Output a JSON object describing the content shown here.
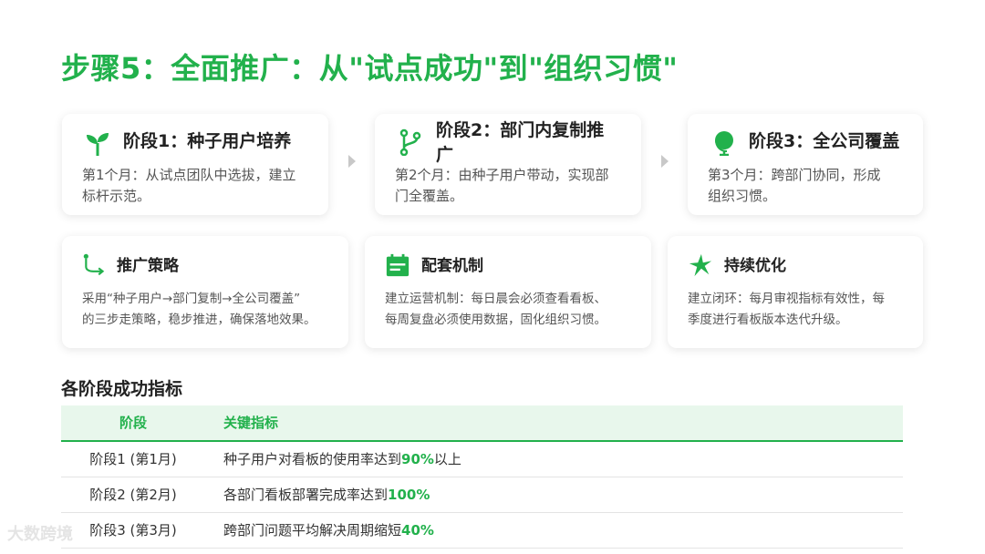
{
  "title": "步骤5：全面推广：从\"试点成功\"到\"组织习惯\"",
  "colors": {
    "accent": "#22b14c",
    "header_bg": "#e8f7ec"
  },
  "phases": [
    {
      "icon": "sprout-icon",
      "title": "阶段1：种子用户培养",
      "desc_l1": "第1个月：从试点团队中选拔，建立",
      "desc_l2": "标杆示范。"
    },
    {
      "icon": "branch-icon",
      "title_l1": "阶段2：部门内复制推",
      "title_l2": "广",
      "desc_l1": "第2个月：由种子用户带动，实现部",
      "desc_l2": "门全覆盖。"
    },
    {
      "icon": "globe-icon",
      "title": "阶段3：全公司覆盖",
      "desc_l1": "第3个月：跨部门协同，形成",
      "desc_l2": "组织习惯。"
    }
  ],
  "features": [
    {
      "icon": "route-icon",
      "title": "推广策略",
      "desc_l1": "采用“种子用户→部门复制→全公司覆盖”",
      "desc_l2": "的三步走策略，稳步推进，确保落地效果。"
    },
    {
      "icon": "calendar-icon",
      "title": "配套机制",
      "desc_l1": "建立运营机制：每日晨会必须查看看板、",
      "desc_l2": "每周复盘必须使用数据，固化组织习惯。"
    },
    {
      "icon": "sparkle-icon",
      "title": "持续优化",
      "desc_l1": "建立闭环：每月审视指标有效性，每",
      "desc_l2": "季度进行看板版本迭代升级。"
    }
  ],
  "metrics": {
    "heading": "各阶段成功指标",
    "columns": [
      "阶段",
      "关键指标"
    ],
    "rows": [
      {
        "stage": "阶段1 (第1月)",
        "text": "种子用户对看板的使用率达到",
        "value": "90%",
        "suffix": "以上"
      },
      {
        "stage": "阶段2 (第2月)",
        "text": "各部门看板部署完成率达到",
        "value": "100%",
        "suffix": ""
      },
      {
        "stage": "阶段3 (第3月)",
        "text": "跨部门问题平均解决周期缩短",
        "value": "40%",
        "suffix": ""
      }
    ]
  },
  "watermark": "大数跨境"
}
